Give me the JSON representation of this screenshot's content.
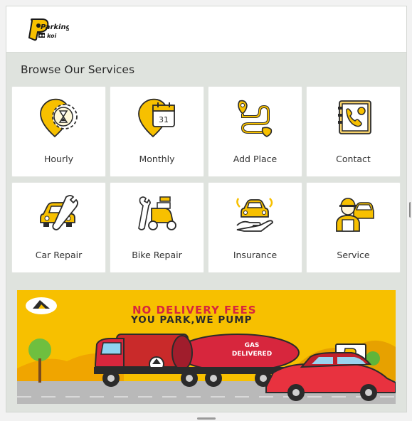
{
  "header": {
    "logo_text_top": "Parking",
    "logo_text_bottom": "koi"
  },
  "browse": {
    "title": "Browse Our Services",
    "items": [
      {
        "label": "Hourly",
        "icon": "hourly-pin-hourglass-icon"
      },
      {
        "label": "Monthly",
        "icon": "monthly-pin-calendar-icon"
      },
      {
        "label": "Add Place",
        "icon": "add-place-route-icon"
      },
      {
        "label": "Contact",
        "icon": "contact-book-phone-icon"
      },
      {
        "label": "Car Repair",
        "icon": "car-repair-wrench-icon"
      },
      {
        "label": "Bike Repair",
        "icon": "bike-repair-scooter-icon"
      },
      {
        "label": "Insurance",
        "icon": "insurance-hand-car-icon"
      },
      {
        "label": "Service",
        "icon": "service-worker-car-icon"
      }
    ]
  },
  "calendar_day": "31",
  "banner": {
    "line1": "NO DELIVERY FEES",
    "line2": "YOU PARK,WE PUMP",
    "truck_text_1": "GAS",
    "truck_text_2": "DELIVERED"
  },
  "colors": {
    "accent": "#f7c000",
    "dark": "#2b2b2b",
    "truck_red": "#d7263d"
  }
}
